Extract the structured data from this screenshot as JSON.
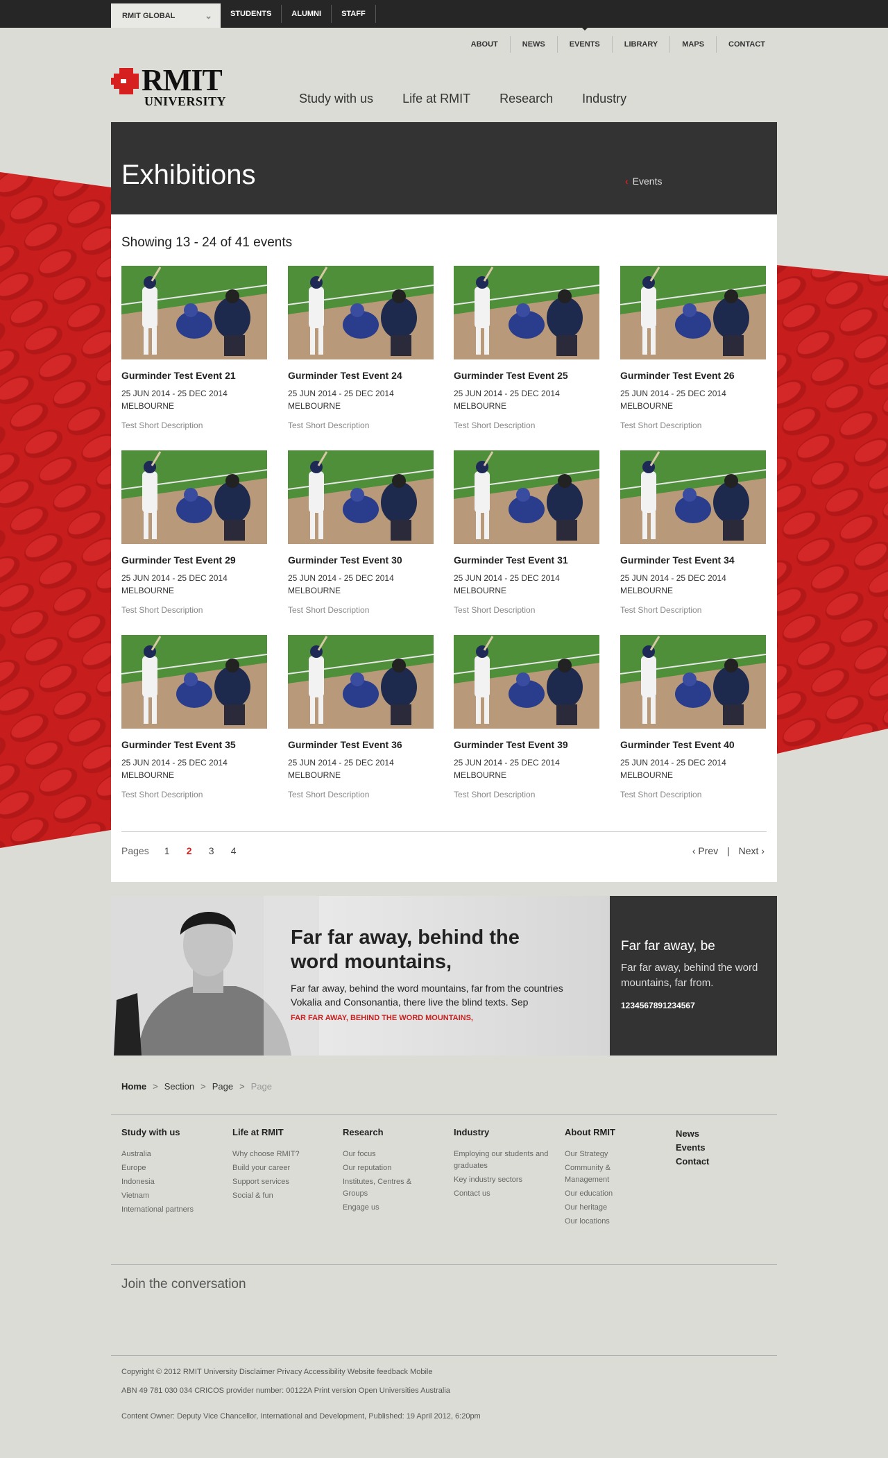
{
  "topbar": {
    "global_select": "RMIT GLOBAL",
    "links": [
      "STUDENTS",
      "ALUMNI",
      "STAFF"
    ]
  },
  "utility_nav": [
    "ABOUT",
    "NEWS",
    "EVENTS",
    "LIBRARY",
    "MAPS",
    "CONTACT"
  ],
  "logo": {
    "line1": "RMIT",
    "line2": "UNIVERSITY"
  },
  "main_nav": [
    "Study with us",
    "Life at RMIT",
    "Research",
    "Industry"
  ],
  "header": {
    "title": "Exhibitions",
    "back_link": "Events"
  },
  "listing": {
    "showing": "Showing 13 - 24 of 41 events",
    "events": [
      {
        "title": "Gurminder Test Event 21",
        "date": "25 JUN 2014 - 25 DEC 2014",
        "location": "MELBOURNE",
        "desc": "Test Short Description"
      },
      {
        "title": "Gurminder Test Event 24",
        "date": "25 JUN 2014 - 25 DEC 2014",
        "location": "MELBOURNE",
        "desc": "Test Short Description"
      },
      {
        "title": "Gurminder Test Event 25",
        "date": "25 JUN 2014 - 25 DEC 2014",
        "location": "MELBOURNE",
        "desc": "Test Short Description"
      },
      {
        "title": "Gurminder Test Event 26",
        "date": "25 JUN 2014 - 25 DEC 2014",
        "location": "MELBOURNE",
        "desc": "Test Short Description"
      },
      {
        "title": "Gurminder Test Event 29",
        "date": "25 JUN 2014 - 25 DEC 2014",
        "location": "MELBOURNE",
        "desc": "Test Short Description"
      },
      {
        "title": "Gurminder Test Event 30",
        "date": "25 JUN 2014 - 25 DEC 2014",
        "location": "MELBOURNE",
        "desc": "Test Short Description"
      },
      {
        "title": "Gurminder Test Event 31",
        "date": "25 JUN 2014 - 25 DEC 2014",
        "location": "MELBOURNE",
        "desc": "Test Short Description"
      },
      {
        "title": "Gurminder Test Event 34",
        "date": "25 JUN 2014 - 25 DEC 2014",
        "location": "MELBOURNE",
        "desc": "Test Short Description"
      },
      {
        "title": "Gurminder Test Event 35",
        "date": "25 JUN 2014 - 25 DEC 2014",
        "location": "MELBOURNE",
        "desc": "Test Short Description"
      },
      {
        "title": "Gurminder Test Event 36",
        "date": "25 JUN 2014 - 25 DEC 2014",
        "location": "MELBOURNE",
        "desc": "Test Short Description"
      },
      {
        "title": "Gurminder Test Event 39",
        "date": "25 JUN 2014 - 25 DEC 2014",
        "location": "MELBOURNE",
        "desc": "Test Short Description"
      },
      {
        "title": "Gurminder Test Event 40",
        "date": "25 JUN 2014 - 25 DEC 2014",
        "location": "MELBOURNE",
        "desc": "Test Short Description"
      }
    ]
  },
  "pagination": {
    "label": "Pages",
    "pages": [
      "1",
      "2",
      "3",
      "4"
    ],
    "current": "2",
    "prev": "Prev",
    "next": "Next"
  },
  "promo": {
    "heading": "Far far away, behind the word mountains,",
    "body": "Far far away, behind the word mountains, far from the countries Vokalia and Consonantia, there live the blind texts. Sep",
    "link": "FAR FAR AWAY, BEHIND THE WORD MOUNTAINS,"
  },
  "promo_side": {
    "heading": "Far far away, be",
    "body": "Far far away, behind the word mountains, far from.",
    "number": "1234567891234567"
  },
  "breadcrumb": [
    "Home",
    "Section",
    "Page",
    "Page"
  ],
  "footer": {
    "columns": [
      {
        "heading": "Study with us",
        "items": [
          "Australia",
          "Europe",
          "Indonesia",
          "Vietnam",
          "International partners"
        ]
      },
      {
        "heading": "Life at RMIT",
        "items": [
          "Why choose RMIT?",
          "Build your career",
          "Support services",
          "Social & fun"
        ]
      },
      {
        "heading": "Research",
        "items": [
          "Our focus",
          "Our reputation",
          "Institutes, Centres & Groups",
          "Engage us"
        ]
      },
      {
        "heading": "Industry",
        "items": [
          "Employing our students and graduates",
          "Key industry sectors",
          "Contact us"
        ]
      },
      {
        "heading": "About RMIT",
        "items": [
          "Our Strategy",
          "Community & Management",
          "Our education",
          "Our heritage",
          "Our locations"
        ]
      }
    ],
    "strong_links": [
      "News",
      "Events",
      "Contact"
    ],
    "join": "Join the conversation",
    "copyright": "Copyright © 2012 RMIT University Disclaimer Privacy Accessibility Website feedback Mobile",
    "abn": "ABN 49 781 030 034 CRICOS provider number: 00122A Print version Open Universities Australia",
    "owner": "Content Owner: Deputy Vice Chancellor, International and Development, Published: 19 April 2012, 6:20pm"
  },
  "colors": {
    "brand_red": "#d62020",
    "dark": "#333333",
    "page_bg": "#dcdcd6"
  }
}
